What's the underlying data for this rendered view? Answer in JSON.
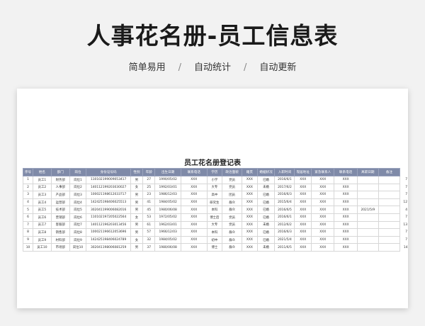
{
  "hero": {
    "title": "人事花名册-员工信息表",
    "features": [
      "简单易用",
      "自动统计",
      "自动更新"
    ],
    "separator": "/"
  },
  "sheet": {
    "title": "员工花名册登记表",
    "header_color": "#7f8aa8",
    "columns": [
      "序号",
      "姓名",
      "部门",
      "岗位",
      "身份证号码",
      "性别",
      "年龄",
      "出生日期",
      "联系电话",
      "学历",
      "政治面貌",
      "籍贯",
      "婚姻状况",
      "入职时间",
      "现居地址",
      "紧急联系人",
      "联系电话",
      "离职日期",
      "备注"
    ],
    "rows": [
      [
        "1",
        "员工1",
        "财务部",
        "岗位1",
        "110102199009053417",
        "男",
        "27",
        "1990/05/02",
        "XXX",
        "小学",
        "党员",
        "XXX",
        "已婚",
        "2016/6/1",
        "XXX",
        "XXX",
        "XXX",
        "",
        "",
        "7"
      ],
      [
        "2",
        "员工2",
        "人事部",
        "岗位2",
        "140112199203030027",
        "女",
        "25",
        "1992/03/01",
        "XXX",
        "大专",
        "党员",
        "XXX",
        "未婚",
        "2017/6/2",
        "XXX",
        "XXX",
        "XXX",
        "",
        "",
        "7"
      ],
      [
        "3",
        "员工3",
        "产品部",
        "岗位3",
        "100021198612033717",
        "男",
        "23",
        "1986/12/03",
        "XXX",
        "高中",
        "团员",
        "XXX",
        "已婚",
        "2016/6/3",
        "XXX",
        "XXX",
        "XXX",
        "",
        "",
        "7"
      ],
      [
        "4",
        "员工4",
        "运营部",
        "岗位4",
        "142425198406025513",
        "男",
        "41",
        "1984/05/02",
        "XXX",
        "研究生",
        "群众",
        "XXX",
        "已婚",
        "2015/6/4",
        "XXX",
        "XXX",
        "XXX",
        "",
        "",
        "12"
      ],
      [
        "5",
        "员工5",
        "技术部",
        "岗位5",
        "302041199006082016",
        "男",
        "45",
        "1980/06/08",
        "XXX",
        "本科",
        "群众",
        "XXX",
        "已婚",
        "2016/6/5",
        "XXX",
        "XXX",
        "XXX",
        "2021/5/9",
        "",
        "4"
      ],
      [
        "6",
        "员工6",
        "营销部",
        "岗位6",
        "110102197205022564",
        "女",
        "53",
        "1972/05/02",
        "XXX",
        "博士后",
        "党员",
        "XXX",
        "已婚",
        "2016/6/1",
        "XXX",
        "XXX",
        "XXX",
        "",
        "",
        "7"
      ],
      [
        "7",
        "员工7",
        "客服部",
        "岗位7",
        "140112196203013456",
        "男",
        "61",
        "1962/03/01",
        "XXX",
        "大专",
        "党员",
        "XXX",
        "未婚",
        "2012/6/2",
        "XXX",
        "XXX",
        "XXX",
        "",
        "",
        "13"
      ],
      [
        "8",
        "员工8",
        "销售部",
        "岗位8",
        "100021196612053696",
        "男",
        "57",
        "1966/12/03",
        "XXX",
        "本科",
        "群众",
        "XXX",
        "已婚",
        "2016/6/3",
        "XXX",
        "XXX",
        "XXX",
        "",
        "",
        "7"
      ],
      [
        "9",
        "员工9",
        "材料部",
        "岗位9",
        "142425198406024789",
        "女",
        "32",
        "1984/05/02",
        "XXX",
        "初中",
        "群众",
        "XXX",
        "已婚",
        "2021/5/4",
        "XXX",
        "XXX",
        "XXX",
        "",
        "",
        "7"
      ],
      [
        "10",
        "员工10",
        "市场部",
        "岗位10",
        "302041198006081259",
        "男",
        "37",
        "1980/06/08",
        "XXX",
        "博士",
        "群众",
        "XXX",
        "未婚",
        "2011/6/5",
        "XXX",
        "XXX",
        "XXX",
        "",
        "",
        "14"
      ]
    ]
  }
}
